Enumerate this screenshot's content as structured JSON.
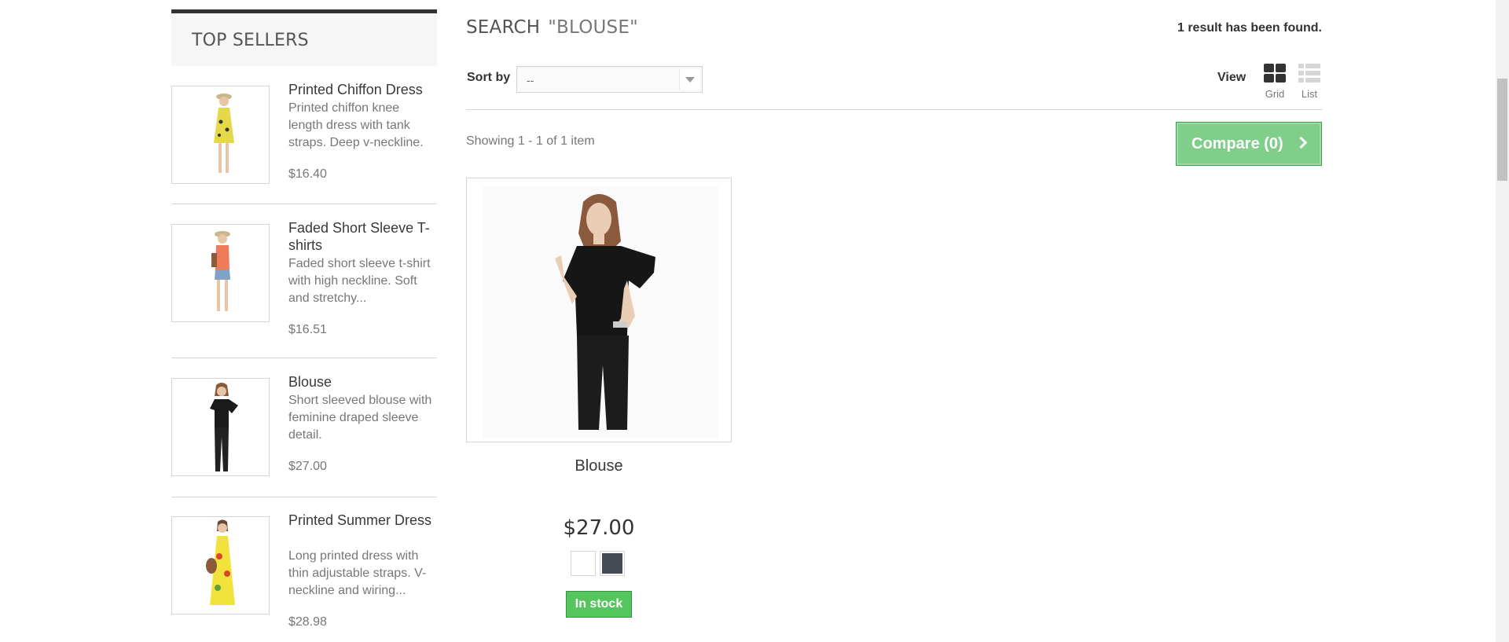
{
  "sidebar": {
    "title": "TOP SELLERS",
    "items": [
      {
        "name": "Printed Chiffon Dress",
        "description": "Printed chiffon knee length dress with tank straps. Deep v-neckline.",
        "price": "$16.40",
        "dress_color": "#e5d94a"
      },
      {
        "name": "Faded Short Sleeve T-shirts",
        "description": "Faded short sleeve t-shirt with high neckline. Soft and stretchy...",
        "price": "$16.51",
        "dress_color": "#ef7b5a"
      },
      {
        "name": "Blouse",
        "description": "Short sleeved blouse with feminine draped sleeve detail.",
        "price": "$27.00",
        "dress_color": "#1a1a1a"
      },
      {
        "name": "Printed Summer Dress",
        "description": "Long printed dress with thin adjustable straps. V-neckline and wiring...",
        "price": "$28.98",
        "dress_color": "#f2e33c"
      }
    ]
  },
  "search": {
    "label": "SEARCH",
    "query": "\"BLOUSE\"",
    "result_count": "1 result has been found."
  },
  "toolbar": {
    "sort_label": "Sort by",
    "sort_value": "--",
    "view_label": "View",
    "grid_label": "Grid",
    "list_label": "List",
    "showing": "Showing 1 - 1 of 1 item",
    "compare_label": "Compare (0)"
  },
  "product": {
    "name": "Blouse",
    "price": "$27.00",
    "colors": [
      "#ffffff",
      "#434a54"
    ],
    "stock": "In stock"
  },
  "colors": {
    "accent_green": "#55c65e",
    "compare_green": "#7fcf8a"
  }
}
